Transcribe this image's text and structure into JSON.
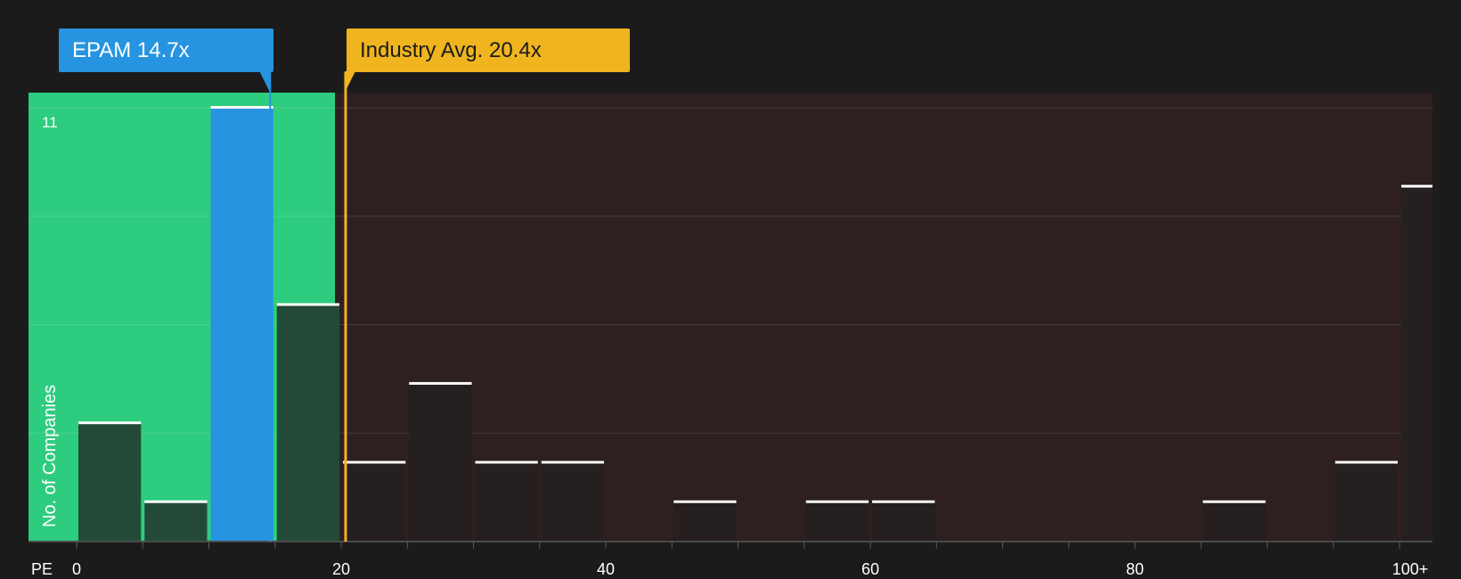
{
  "company": {
    "name": "EPAM",
    "pe": 14.7,
    "pe_label": "14.7x"
  },
  "industry": {
    "name": "Industry Avg.",
    "pe": 20.4,
    "pe_label": "20.4x"
  },
  "colors": {
    "background": "#1b1b1c",
    "undervalued_zone": "#2ecc7f",
    "overvalued_zone": "#2e1f20",
    "company_bar": "#2694e0",
    "industry_line": "#f0b41f",
    "bar_cap": "#ffffff"
  },
  "chart_data": {
    "type": "bar",
    "xlabel": "PE",
    "ylabel": "No. of Companies",
    "bin_width": 5,
    "bin_starts": [
      0,
      5,
      10,
      15,
      20,
      25,
      30,
      35,
      40,
      45,
      50,
      55,
      60,
      65,
      70,
      75,
      80,
      85,
      90,
      95,
      100
    ],
    "values": [
      3,
      1,
      11,
      6,
      2,
      4,
      2,
      2,
      0,
      1,
      0,
      1,
      1,
      0,
      0,
      0,
      0,
      1,
      0,
      2,
      9
    ],
    "highlight_bin_start": 10,
    "x_ticks": [
      {
        "value": 0,
        "label": "0"
      },
      {
        "value": 20,
        "label": "20"
      },
      {
        "value": 40,
        "label": "40"
      },
      {
        "value": 60,
        "label": "60"
      },
      {
        "value": 80,
        "label": "80"
      },
      {
        "value": 100,
        "label": "100+"
      }
    ],
    "y_max_label": "11",
    "ylim": [
      0,
      11
    ],
    "grid": true
  }
}
